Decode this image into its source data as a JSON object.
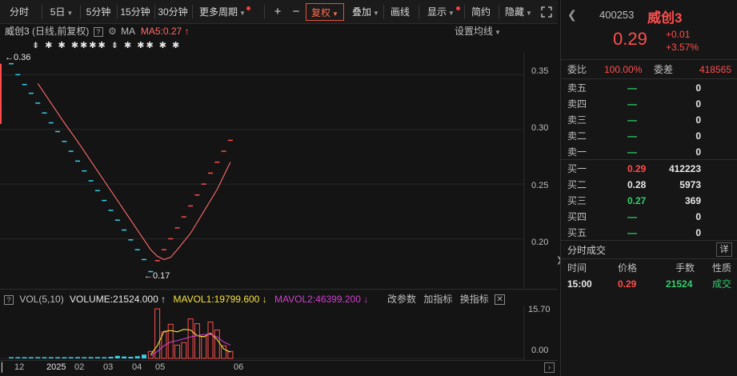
{
  "toolbar": {
    "period_items": [
      "分时",
      "5日",
      "5分钟",
      "15分钟",
      "30分钟",
      "更多周期"
    ],
    "plus": "+",
    "minus": "−",
    "fuquan": "复权",
    "overlay": "叠加",
    "draw": "画线",
    "display": "显示",
    "simple": "简约",
    "hide": "隐藏",
    "fullscreen_icon": "fullscreen-icon"
  },
  "chart_header": {
    "stock_name": "威创3",
    "mode": "(日线,前复权)",
    "ma_label": "MA",
    "ma5": "MA5:0.27",
    "ma5_arrow": "↑",
    "settings": "设置均线",
    "markers": "⇟ ✱ ✱ ✱✱✱✱ ⇟ ✱ ✱✱ ✱ ✱",
    "high_label": "0.36",
    "low_label": "0.17"
  },
  "volume_header": {
    "label": "VOL(5,10)",
    "volume": "VOLUME:21524.000",
    "volume_arrow": "↑",
    "mavol1": "MAVOL1:19799.600",
    "mavol1_arrow": "↓",
    "mavol2": "MAVOL2:46399.200",
    "mavol2_arrow": "↓",
    "change_params": "改参数",
    "add_indicator": "加指标",
    "switch_indicator": "换指标"
  },
  "y_axis": [
    "0.35",
    "0.30",
    "0.25",
    "0.20"
  ],
  "vol_axis": [
    "15.70",
    "0.00"
  ],
  "x_axis": [
    "12",
    "2025",
    "02",
    "03",
    "04",
    "05",
    "06"
  ],
  "colors": {
    "up": "#ff4d4d",
    "down": "#35d0e8",
    "ma5": "#ff6b6b",
    "mavol1": "#f5e23a",
    "mavol2": "#d03ed0",
    "green": "#2fd06b"
  },
  "chart_data": {
    "type": "line",
    "title": "威创3",
    "ylabel": "",
    "ylim": [
      0.155,
      0.37
    ],
    "price_bars": [
      {
        "i": 0,
        "v": 0.36,
        "d": "down"
      },
      {
        "i": 1,
        "v": 0.35,
        "d": "down"
      },
      {
        "i": 2,
        "v": 0.341,
        "d": "down"
      },
      {
        "i": 3,
        "v": 0.333,
        "d": "down"
      },
      {
        "i": 4,
        "v": 0.324,
        "d": "down"
      },
      {
        "i": 5,
        "v": 0.315,
        "d": "down"
      },
      {
        "i": 6,
        "v": 0.306,
        "d": "down"
      },
      {
        "i": 7,
        "v": 0.298,
        "d": "down"
      },
      {
        "i": 8,
        "v": 0.289,
        "d": "down"
      },
      {
        "i": 9,
        "v": 0.28,
        "d": "down"
      },
      {
        "i": 10,
        "v": 0.271,
        "d": "down"
      },
      {
        "i": 11,
        "v": 0.262,
        "d": "down"
      },
      {
        "i": 12,
        "v": 0.253,
        "d": "down"
      },
      {
        "i": 13,
        "v": 0.244,
        "d": "down"
      },
      {
        "i": 14,
        "v": 0.235,
        "d": "down"
      },
      {
        "i": 15,
        "v": 0.226,
        "d": "down"
      },
      {
        "i": 16,
        "v": 0.217,
        "d": "down"
      },
      {
        "i": 17,
        "v": 0.208,
        "d": "down"
      },
      {
        "i": 18,
        "v": 0.199,
        "d": "down"
      },
      {
        "i": 19,
        "v": 0.19,
        "d": "down"
      },
      {
        "i": 20,
        "v": 0.181,
        "d": "down"
      },
      {
        "i": 21,
        "v": 0.17,
        "d": "down"
      },
      {
        "i": 22,
        "v": 0.18,
        "d": "up"
      },
      {
        "i": 23,
        "v": 0.19,
        "d": "up"
      },
      {
        "i": 24,
        "v": 0.2,
        "d": "up"
      },
      {
        "i": 25,
        "v": 0.21,
        "d": "up"
      },
      {
        "i": 26,
        "v": 0.22,
        "d": "up"
      },
      {
        "i": 27,
        "v": 0.23,
        "d": "up"
      },
      {
        "i": 28,
        "v": 0.24,
        "d": "up"
      },
      {
        "i": 29,
        "v": 0.25,
        "d": "up"
      },
      {
        "i": 30,
        "v": 0.26,
        "d": "up"
      },
      {
        "i": 31,
        "v": 0.27,
        "d": "up"
      },
      {
        "i": 32,
        "v": 0.28,
        "d": "up"
      },
      {
        "i": 33,
        "v": 0.29,
        "d": "up"
      }
    ],
    "ma5": [
      {
        "i": 4,
        "v": 0.342
      },
      {
        "i": 6,
        "v": 0.324
      },
      {
        "i": 8,
        "v": 0.306
      },
      {
        "i": 10,
        "v": 0.289
      },
      {
        "i": 12,
        "v": 0.271
      },
      {
        "i": 14,
        "v": 0.253
      },
      {
        "i": 16,
        "v": 0.235
      },
      {
        "i": 18,
        "v": 0.217
      },
      {
        "i": 20,
        "v": 0.199
      },
      {
        "i": 21,
        "v": 0.19
      },
      {
        "i": 22,
        "v": 0.184
      },
      {
        "i": 23,
        "v": 0.181
      },
      {
        "i": 24,
        "v": 0.183
      },
      {
        "i": 25,
        "v": 0.19
      },
      {
        "i": 27,
        "v": 0.205
      },
      {
        "i": 29,
        "v": 0.225
      },
      {
        "i": 31,
        "v": 0.245
      },
      {
        "i": 33,
        "v": 0.27
      }
    ],
    "volume_bars": [
      {
        "i": 0,
        "v": 0.3,
        "d": "down"
      },
      {
        "i": 1,
        "v": 0.2,
        "d": "down"
      },
      {
        "i": 2,
        "v": 0.2,
        "d": "down"
      },
      {
        "i": 3,
        "v": 0.3,
        "d": "down"
      },
      {
        "i": 4,
        "v": 0.2,
        "d": "down"
      },
      {
        "i": 5,
        "v": 0.2,
        "d": "down"
      },
      {
        "i": 6,
        "v": 0.3,
        "d": "down"
      },
      {
        "i": 7,
        "v": 0.2,
        "d": "down"
      },
      {
        "i": 8,
        "v": 0.3,
        "d": "down"
      },
      {
        "i": 9,
        "v": 0.3,
        "d": "down"
      },
      {
        "i": 10,
        "v": 0.4,
        "d": "down"
      },
      {
        "i": 11,
        "v": 0.3,
        "d": "down"
      },
      {
        "i": 12,
        "v": 0.4,
        "d": "down"
      },
      {
        "i": 13,
        "v": 0.4,
        "d": "down"
      },
      {
        "i": 14,
        "v": 0.3,
        "d": "down"
      },
      {
        "i": 15,
        "v": 0.5,
        "d": "down"
      },
      {
        "i": 16,
        "v": 0.8,
        "d": "down"
      },
      {
        "i": 17,
        "v": 0.6,
        "d": "down"
      },
      {
        "i": 18,
        "v": 0.5,
        "d": "down"
      },
      {
        "i": 19,
        "v": 0.7,
        "d": "down"
      },
      {
        "i": 20,
        "v": 1.2,
        "d": "down"
      },
      {
        "i": 21,
        "v": 2.2,
        "d": "up"
      },
      {
        "i": 22,
        "v": 15.7,
        "d": "up"
      },
      {
        "i": 23,
        "v": 8.4,
        "d": "up"
      },
      {
        "i": 24,
        "v": 10.8,
        "d": "up"
      },
      {
        "i": 25,
        "v": 4.2,
        "d": "up"
      },
      {
        "i": 26,
        "v": 5.0,
        "d": "up"
      },
      {
        "i": 27,
        "v": 12.5,
        "d": "up"
      },
      {
        "i": 28,
        "v": 11.0,
        "d": "up"
      },
      {
        "i": 29,
        "v": 7.0,
        "d": "up"
      },
      {
        "i": 30,
        "v": 11.5,
        "d": "up"
      },
      {
        "i": 31,
        "v": 9.0,
        "d": "up"
      },
      {
        "i": 32,
        "v": 4.0,
        "d": "up"
      },
      {
        "i": 33,
        "v": 2.2,
        "d": "up"
      }
    ],
    "mavol1": [
      {
        "i": 21,
        "v": 1.2
      },
      {
        "i": 22,
        "v": 4.0
      },
      {
        "i": 23,
        "v": 8.5
      },
      {
        "i": 24,
        "v": 8.8
      },
      {
        "i": 25,
        "v": 8.4
      },
      {
        "i": 26,
        "v": 9.2
      },
      {
        "i": 27,
        "v": 9.0
      },
      {
        "i": 28,
        "v": 7.2
      },
      {
        "i": 29,
        "v": 6.8
      },
      {
        "i": 30,
        "v": 8.0
      },
      {
        "i": 31,
        "v": 6.0
      },
      {
        "i": 32,
        "v": 3.0
      },
      {
        "i": 33,
        "v": 2.0
      }
    ],
    "mavol2": [
      {
        "i": 21,
        "v": 0.8
      },
      {
        "i": 22,
        "v": 2.2
      },
      {
        "i": 23,
        "v": 4.0
      },
      {
        "i": 24,
        "v": 5.2
      },
      {
        "i": 25,
        "v": 5.6
      },
      {
        "i": 26,
        "v": 6.2
      },
      {
        "i": 27,
        "v": 6.8
      },
      {
        "i": 28,
        "v": 7.2
      },
      {
        "i": 29,
        "v": 7.6
      },
      {
        "i": 30,
        "v": 7.6
      },
      {
        "i": 31,
        "v": 6.8
      },
      {
        "i": 32,
        "v": 5.2
      },
      {
        "i": 33,
        "v": 4.2
      }
    ],
    "vol_ylim": [
      0,
      15.7
    ],
    "grid": true
  },
  "quote": {
    "code": "400253",
    "name": "威创3",
    "price": "0.29",
    "change": "+0.01",
    "change_pct": "+3.57%"
  },
  "order_ratio": {
    "label": "委比",
    "value": "100.00%",
    "diff_label": "委差",
    "diff_value": "418565"
  },
  "asks": [
    {
      "label": "卖五",
      "price": "—",
      "vol": "0"
    },
    {
      "label": "卖四",
      "price": "—",
      "vol": "0"
    },
    {
      "label": "卖三",
      "price": "—",
      "vol": "0"
    },
    {
      "label": "卖二",
      "price": "—",
      "vol": "0"
    },
    {
      "label": "卖一",
      "price": "—",
      "vol": "0"
    }
  ],
  "bids": [
    {
      "label": "买一",
      "price": "0.29",
      "vol": "412223",
      "pc": "red"
    },
    {
      "label": "买二",
      "price": "0.28",
      "vol": "5973",
      "pc": "white"
    },
    {
      "label": "买三",
      "price": "0.27",
      "vol": "369",
      "pc": "green"
    },
    {
      "label": "买四",
      "price": "—",
      "vol": "0",
      "pc": "green"
    },
    {
      "label": "买五",
      "price": "—",
      "vol": "0",
      "pc": "green"
    }
  ],
  "trades": {
    "title": "分时成交",
    "detail_button": "详",
    "headers": [
      "时间",
      "价格",
      "手数",
      "性质"
    ],
    "rows": [
      {
        "time": "15:00",
        "price": "0.29",
        "vol": "21524",
        "type": "成交"
      }
    ]
  }
}
